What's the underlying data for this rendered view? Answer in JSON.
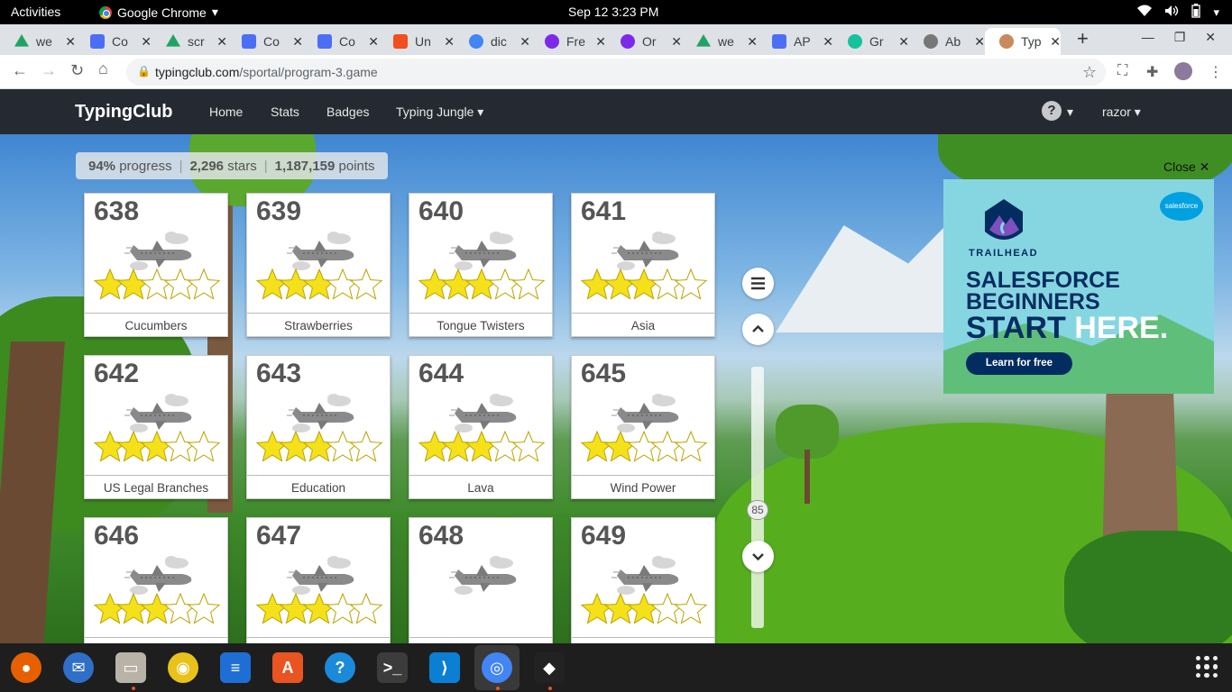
{
  "system_bar": {
    "activities": "Activities",
    "app_name": "Google Chrome",
    "datetime": "Sep 12  3:23 PM"
  },
  "tabs": [
    {
      "label": "we",
      "icon": "google-drive-icon"
    },
    {
      "label": "Co",
      "icon": "google-docs-icon"
    },
    {
      "label": "scr",
      "icon": "google-drive-icon"
    },
    {
      "label": "Co",
      "icon": "google-docs-icon"
    },
    {
      "label": "Co",
      "icon": "google-docs-icon"
    },
    {
      "label": "Un",
      "icon": "figma-icon"
    },
    {
      "label": "dic",
      "icon": "google-icon"
    },
    {
      "label": "Fre",
      "icon": "canva-icon"
    },
    {
      "label": "Or",
      "icon": "canva-icon"
    },
    {
      "label": "we",
      "icon": "google-drive-icon"
    },
    {
      "label": "AP",
      "icon": "google-docs-icon"
    },
    {
      "label": "Gr",
      "icon": "grammarly-icon"
    },
    {
      "label": "Ab",
      "icon": "globe-icon"
    },
    {
      "label": "Typ",
      "icon": "typingclub-icon",
      "active": true
    }
  ],
  "address_bar": {
    "host": "typingclub.com",
    "path": "/sportal/program-3.game"
  },
  "site_nav": {
    "brand": "TypingClub",
    "links": [
      "Home",
      "Stats",
      "Badges",
      "Typing Jungle"
    ],
    "user": "razor"
  },
  "progress": {
    "percent": "94%",
    "percent_label": "progress",
    "stars": "2,296",
    "stars_label": "stars",
    "points": "1,187,159",
    "points_label": "points"
  },
  "lessons": [
    {
      "number": "638",
      "title": "Cucumbers",
      "stars": 2
    },
    {
      "number": "639",
      "title": "Strawberries",
      "stars": 3
    },
    {
      "number": "640",
      "title": "Tongue Twisters",
      "stars": 3
    },
    {
      "number": "641",
      "title": "Asia",
      "stars": 3
    },
    {
      "number": "642",
      "title": "US Legal Branches",
      "stars": 3
    },
    {
      "number": "643",
      "title": "Education",
      "stars": 3
    },
    {
      "number": "644",
      "title": "Lava",
      "stars": 3
    },
    {
      "number": "645",
      "title": "Wind Power",
      "stars": 2
    },
    {
      "number": "646",
      "title": "",
      "stars": 3
    },
    {
      "number": "647",
      "title": "",
      "stars": 3
    },
    {
      "number": "648",
      "title": "",
      "stars": 0
    },
    {
      "number": "649",
      "title": "",
      "stars": 3
    }
  ],
  "scroller": {
    "position_label": "85"
  },
  "ad": {
    "close_label": "Close ✕",
    "brand_small": "salesforce",
    "trailhead": "TRAILHEAD",
    "line1": "SALESFORCE",
    "line2": "BEGINNERS",
    "line3a": "START",
    "line3b": "HERE.",
    "cta": "Learn for free"
  },
  "colors": {
    "nav_bg": "#252a32",
    "star_gold": "#f5e11a",
    "ad_bg": "#86d6e2",
    "ad_navy": "#032d60"
  },
  "dock": [
    {
      "name": "firefox-icon",
      "color": "#e66000"
    },
    {
      "name": "thunderbird-icon",
      "color": "#2f6fc7"
    },
    {
      "name": "files-icon",
      "color": "#b9b2a6"
    },
    {
      "name": "rhythmbox-icon",
      "color": "#e8c21a"
    },
    {
      "name": "libreoffice-writer-icon",
      "color": "#1e6ed5"
    },
    {
      "name": "ubuntu-software-icon",
      "color": "#e95420"
    },
    {
      "name": "help-icon",
      "color": "#1c8adb"
    },
    {
      "name": "terminal-icon",
      "color": "#3c3c3c"
    },
    {
      "name": "vscode-icon",
      "color": "#0b7fd4"
    },
    {
      "name": "chrome-icon",
      "color": "#4285f4"
    },
    {
      "name": "figma-icon",
      "color": "#222222"
    }
  ]
}
